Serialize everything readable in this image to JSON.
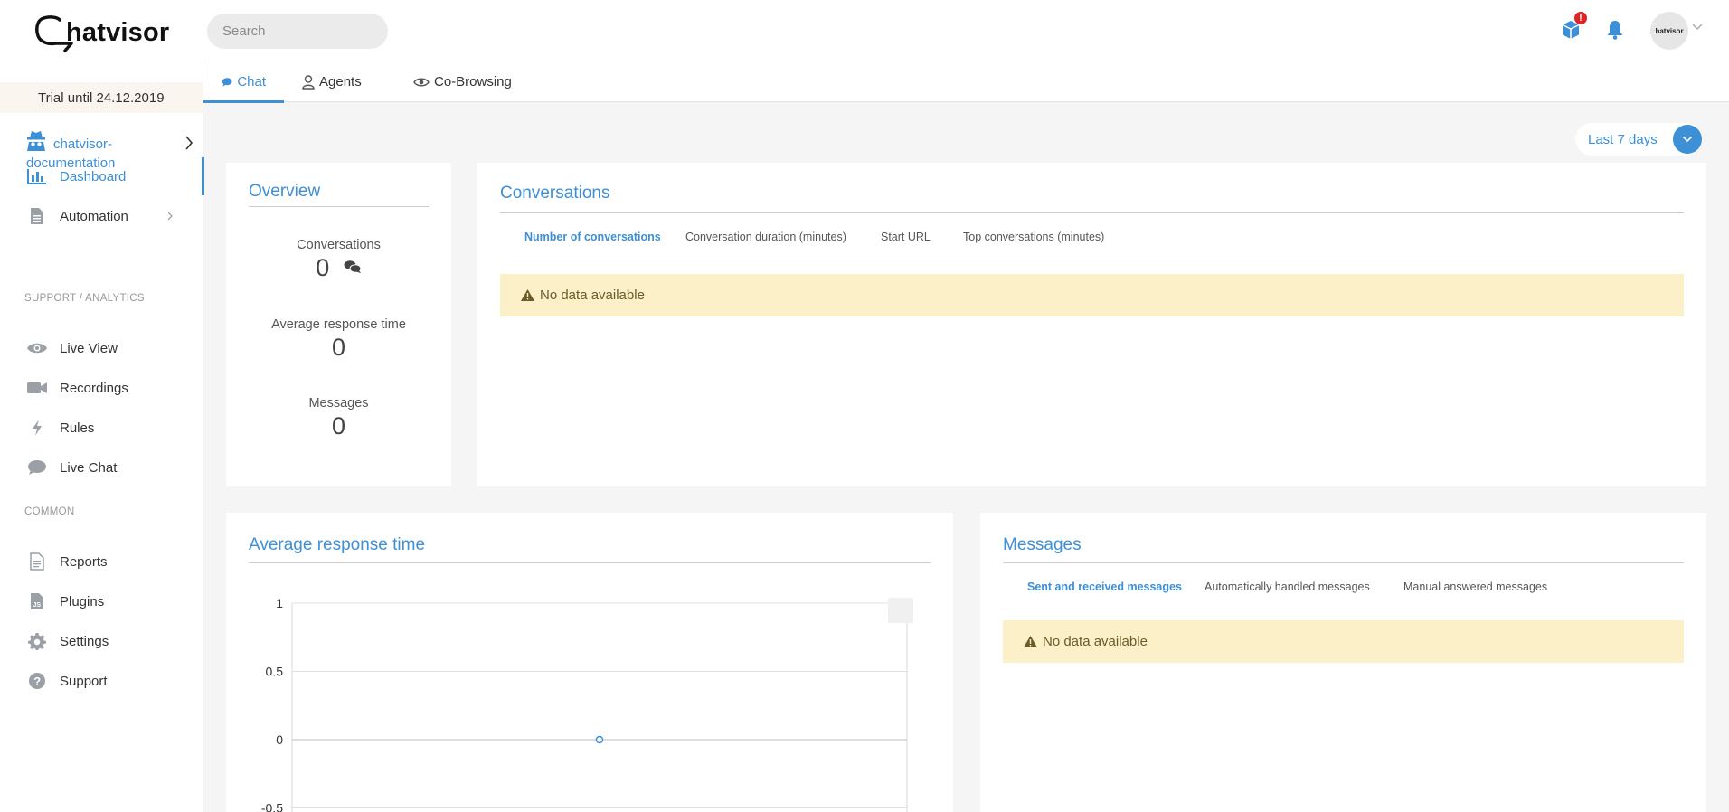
{
  "header": {
    "logo_text": "hatvisor",
    "search_placeholder": "Search",
    "notification_badge": "!",
    "avatar_text": "hatvisor",
    "colors": {
      "accent": "#3d8fd6",
      "badge": "#e02424"
    }
  },
  "sidebar": {
    "trial_text": "Trial until 24.12.2019",
    "project_name": "chatvisor-documentation",
    "items": [
      {
        "label": "Dashboard",
        "icon": "bar-chart-icon"
      },
      {
        "label": "Automation",
        "icon": "document-icon"
      },
      {
        "label": "Live View",
        "icon": "eye-icon"
      },
      {
        "label": "Recordings",
        "icon": "video-camera-icon"
      },
      {
        "label": "Rules",
        "icon": "lightning-icon"
      },
      {
        "label": "Live Chat",
        "icon": "chat-bubble-icon"
      },
      {
        "label": "Reports",
        "icon": "report-icon"
      },
      {
        "label": "Plugins",
        "icon": "js-file-icon"
      },
      {
        "label": "Settings",
        "icon": "gear-icon"
      },
      {
        "label": "Support",
        "icon": "help-icon"
      }
    ],
    "sections": {
      "support": "SUPPORT / ANALYTICS",
      "common": "COMMON"
    }
  },
  "tabs": [
    {
      "label": "Chat"
    },
    {
      "label": "Agents"
    },
    {
      "label": "Co-Browsing"
    }
  ],
  "date_range": {
    "label": "Last 7 days"
  },
  "overview": {
    "title": "Overview",
    "stats": [
      {
        "label": "Conversations",
        "value": "0"
      },
      {
        "label": "Average response time",
        "value": "0"
      },
      {
        "label": "Messages",
        "value": "0"
      }
    ]
  },
  "conversations": {
    "title": "Conversations",
    "tabs": [
      "Number of conversations",
      "Conversation duration (minutes)",
      "Start URL",
      "Top conversations (minutes)"
    ],
    "alert": "No data available"
  },
  "avg_response": {
    "title": "Average response time"
  },
  "messages": {
    "title": "Messages",
    "tabs": [
      "Sent and received messages",
      "Automatically handled messages",
      "Manual answered messages"
    ],
    "alert": "No data available"
  },
  "chart_data": {
    "type": "line",
    "title": "Average response time",
    "xlabel": "",
    "ylabel": "",
    "y_ticks": [
      "1",
      "0.5",
      "0",
      "-0.5"
    ],
    "ylim": [
      -0.5,
      1
    ],
    "series": [
      {
        "values": [
          0
        ]
      }
    ],
    "grid": true
  }
}
